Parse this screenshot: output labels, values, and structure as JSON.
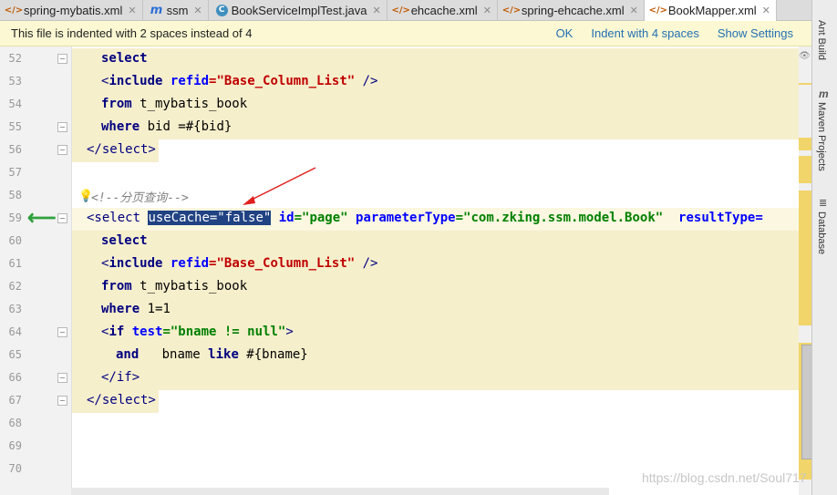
{
  "tabs": [
    {
      "label": "spring-mybatis.xml",
      "icon": "xml-file-icon"
    },
    {
      "label": "ssm",
      "icon": "module-icon"
    },
    {
      "label": "BookServiceImplTest.java",
      "icon": "java-class-icon"
    },
    {
      "label": "ehcache.xml",
      "icon": "xml-file-icon"
    },
    {
      "label": "spring-ehcache.xml",
      "icon": "xml-file-icon"
    },
    {
      "label": "BookMapper.xml",
      "icon": "xml-file-icon",
      "active": true
    }
  ],
  "notification": {
    "message": "This file is indented with 2 spaces instead of 4",
    "ok": "OK",
    "indent": "Indent with 4 spaces",
    "settings": "Show Settings"
  },
  "lines": [
    {
      "n": "52"
    },
    {
      "n": "53"
    },
    {
      "n": "54"
    },
    {
      "n": "55"
    },
    {
      "n": "56"
    },
    {
      "n": "57"
    },
    {
      "n": "58"
    },
    {
      "n": "59"
    },
    {
      "n": "60"
    },
    {
      "n": "61"
    },
    {
      "n": "62"
    },
    {
      "n": "63"
    },
    {
      "n": "64"
    },
    {
      "n": "65"
    },
    {
      "n": "66"
    },
    {
      "n": "67"
    },
    {
      "n": "68"
    },
    {
      "n": "69"
    },
    {
      "n": "70"
    }
  ],
  "code": {
    "l52": {
      "select": "select"
    },
    "l53": {
      "open": "<",
      "include": "include",
      "refid": "refid",
      "eq": "=",
      "val": "\"Base_Column_List\"",
      "close": " />"
    },
    "l54": {
      "from": "from",
      "table": " t_mybatis_book"
    },
    "l55": {
      "where": "where",
      "rest": " bid =#{bid}"
    },
    "l56": {
      "end": "</select>"
    },
    "l58": {
      "comment": "<!--分页查询-->"
    },
    "l59": {
      "open": "<select ",
      "usecache": "useCache=\"false\"",
      "sp": " ",
      "id": "id",
      "idval": "=\"page\"",
      "pt": " parameterType",
      "ptval": "=\"com.zking.ssm.model.Book\"",
      "rt": "  resultType="
    },
    "l60": {
      "select": "select"
    },
    "l61": {
      "open": "<",
      "include": "include",
      "refid": "refid",
      "eq": "=",
      "val": "\"Base_Column_List\"",
      "close": " />"
    },
    "l62": {
      "from": "from",
      "table": " t_mybatis_book"
    },
    "l63": {
      "where": "where",
      "rest": " 1=1"
    },
    "l64": {
      "open": "<",
      "iftag": "if",
      "test": " test",
      "val": "=\"bname != null\"",
      "close": ">"
    },
    "l65": {
      "and": "and",
      "rest": "   bname ",
      "like": "like",
      "rest2": " #{bname}"
    },
    "l66": {
      "end": "</if>"
    },
    "l67": {
      "end": "</select>"
    }
  },
  "side_tabs": {
    "ant": "Ant Build",
    "maven": "Maven Projects",
    "db": "Database"
  },
  "watermark": "https://blog.csdn.net/Soul717",
  "colors": {
    "highlight": "#f6efcc",
    "selection": "#214283",
    "marker": "#f1d56a",
    "arrow": "#2fa03c",
    "annotation_arrow": "#e02020"
  }
}
